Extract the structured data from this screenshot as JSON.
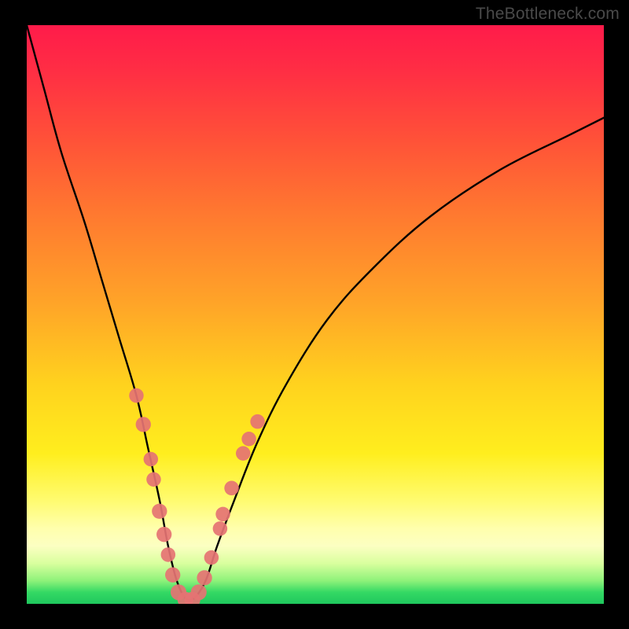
{
  "watermark": {
    "text": "TheBottleneck.com"
  },
  "chart_data": {
    "type": "line",
    "title": "",
    "xlabel": "",
    "ylabel": "",
    "xlim": [
      0,
      100
    ],
    "ylim": [
      0,
      100
    ],
    "series": [
      {
        "name": "bottleneck-curve",
        "x": [
          0,
          3,
          6,
          10,
          13,
          16,
          19,
          21,
          23,
          24.5,
          26,
          27.5,
          29,
          31,
          33,
          36,
          40,
          45,
          52,
          60,
          70,
          82,
          94,
          100
        ],
        "y": [
          100,
          89,
          78,
          66,
          56,
          46,
          36,
          27,
          18,
          10,
          4,
          1,
          1,
          4,
          10,
          18,
          28,
          38,
          49,
          58,
          67,
          75,
          81,
          84
        ]
      }
    ],
    "markers": {
      "name": "highlighted-points",
      "color": "#e57373",
      "points": [
        {
          "x": 19.0,
          "y": 36.0,
          "r": 1.3
        },
        {
          "x": 20.2,
          "y": 31.0,
          "r": 1.4
        },
        {
          "x": 21.5,
          "y": 25.0,
          "r": 1.3
        },
        {
          "x": 22.0,
          "y": 21.5,
          "r": 1.3
        },
        {
          "x": 23.0,
          "y": 16.0,
          "r": 1.4
        },
        {
          "x": 23.8,
          "y": 12.0,
          "r": 1.4
        },
        {
          "x": 24.5,
          "y": 8.5,
          "r": 1.3
        },
        {
          "x": 25.3,
          "y": 5.0,
          "r": 1.4
        },
        {
          "x": 26.3,
          "y": 2.0,
          "r": 1.5
        },
        {
          "x": 27.5,
          "y": 0.7,
          "r": 1.5
        },
        {
          "x": 28.7,
          "y": 0.7,
          "r": 1.5
        },
        {
          "x": 29.8,
          "y": 2.0,
          "r": 1.5
        },
        {
          "x": 30.8,
          "y": 4.5,
          "r": 1.4
        },
        {
          "x": 32.0,
          "y": 8.0,
          "r": 1.3
        },
        {
          "x": 33.5,
          "y": 13.0,
          "r": 1.3
        },
        {
          "x": 34.0,
          "y": 15.5,
          "r": 1.3
        },
        {
          "x": 35.5,
          "y": 20.0,
          "r": 1.3
        },
        {
          "x": 37.5,
          "y": 26.0,
          "r": 1.3
        },
        {
          "x": 38.5,
          "y": 28.5,
          "r": 1.3
        },
        {
          "x": 40.0,
          "y": 31.5,
          "r": 1.3
        }
      ]
    }
  }
}
